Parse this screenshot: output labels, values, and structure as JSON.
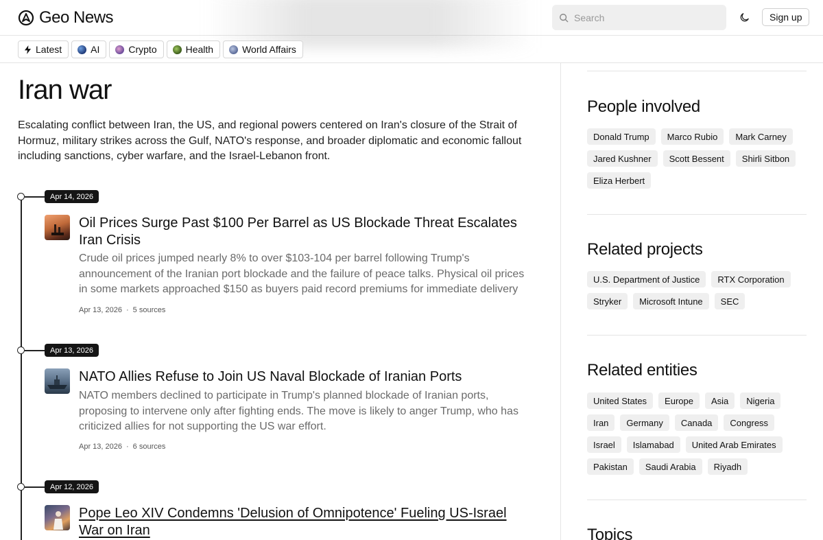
{
  "header": {
    "brand": "Geo News",
    "search_placeholder": "Search",
    "signup_label": "Sign up"
  },
  "categories": [
    {
      "label": "Latest",
      "icon": "bolt-icon"
    },
    {
      "label": "AI",
      "icon": "globe-icon",
      "color": "#2b4a8a"
    },
    {
      "label": "Crypto",
      "icon": "crypto-icon",
      "color": "#7a5aa8"
    },
    {
      "label": "Health",
      "icon": "health-icon",
      "color": "#4a7a2a"
    },
    {
      "label": "World Affairs",
      "icon": "world-icon",
      "color": "#6a7aa0"
    }
  ],
  "topic": {
    "title": "Iran war",
    "description": "Escalating conflict between Iran, the US, and regional powers centered on Iran's closure of the Strait of Hormuz, military strikes across the Gulf, NATO's response, and broader diplomatic and economic fallout including sanctions, cyber warfare, and the Israel-Lebanon front."
  },
  "stories": [
    {
      "date_pill": "Apr 14, 2026",
      "title": "Oil Prices Surge Past $100 Per Barrel as US Blockade Threat Escalates Iran Crisis",
      "summary": "Crude oil prices jumped nearly 8% to over $103-104 per barrel following Trump's announcement of the Iranian port blockade and the failure of peace talks. Physical oil prices in some markets approached $150 as buyers paid record premiums for immediate delivery amid supply disruption…",
      "meta_date": "Apr 13, 2026",
      "meta_sep": "·",
      "sources": "5 sources"
    },
    {
      "date_pill": "Apr 13, 2026",
      "title": "NATO Allies Refuse to Join US Naval Blockade of Iranian Ports",
      "summary": "NATO members declined to participate in Trump's planned blockade of Iranian ports, proposing to intervene only after fighting ends. The move is likely to anger Trump, who has criticized allies for not supporting the US war effort.",
      "meta_date": "Apr 13, 2026",
      "meta_sep": "·",
      "sources": "6 sources"
    },
    {
      "date_pill": "Apr 12, 2026",
      "title": "Pope Leo XIV Condemns 'Delusion of Omnipotence' Fueling US-Israel War on Iran"
    }
  ],
  "sidebar": {
    "people": {
      "title": "People involved",
      "items": [
        "Donald Trump",
        "Marco Rubio",
        "Mark Carney",
        "Jared Kushner",
        "Scott Bessent",
        "Shirli Sitbon",
        "Eliza Herbert"
      ]
    },
    "projects": {
      "title": "Related projects",
      "items": [
        "U.S. Department of Justice",
        "RTX Corporation",
        "Stryker",
        "Microsoft Intune",
        "SEC"
      ]
    },
    "entities": {
      "title": "Related entities",
      "items": [
        "United States",
        "Europe",
        "Asia",
        "Nigeria",
        "Iran",
        "Germany",
        "Canada",
        "Congress",
        "Israel",
        "Islamabad",
        "United Arab Emirates",
        "Pakistan",
        "Saudi Arabia",
        "Riyadh"
      ]
    },
    "topics": {
      "title": "Topics"
    }
  }
}
